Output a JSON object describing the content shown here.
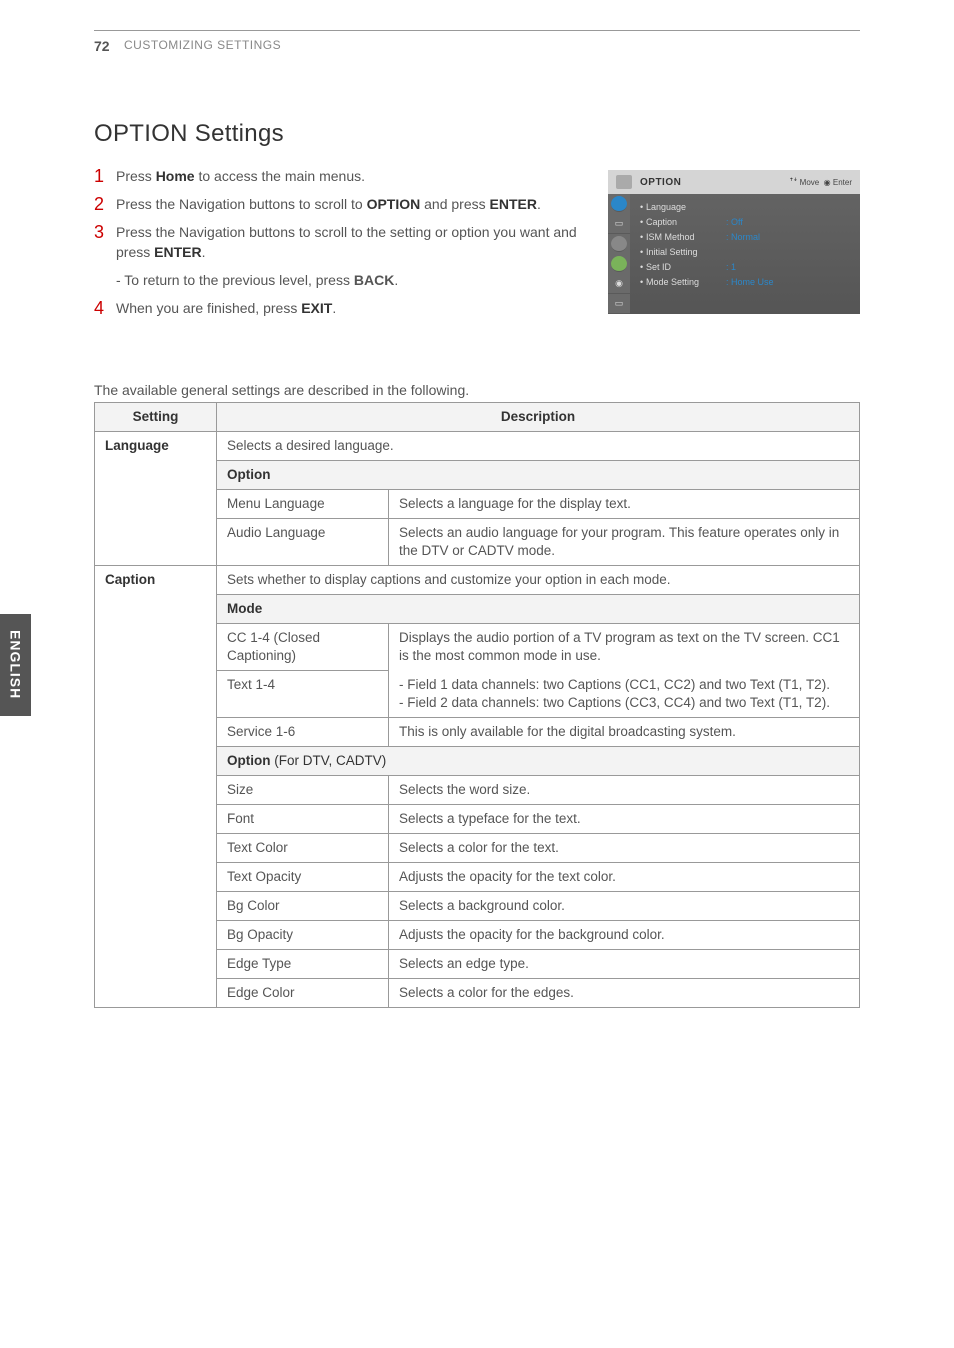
{
  "pageNumber": "72",
  "headerTitle": "CUSTOMIZING SETTINGS",
  "mainHeading": "OPTION Settings",
  "sideTab": "ENGLISH",
  "steps": [
    {
      "num": "1",
      "pre": "Press ",
      "bold1": "Home",
      "post": " to access the main menus."
    },
    {
      "num": "2",
      "pre": "Press the Navigation buttons to scroll to ",
      "bold1": "OPTION",
      "mid": " and press ",
      "bold2": "ENTER",
      "post": "."
    },
    {
      "num": "3",
      "pre": "Press the Navigation buttons to scroll to the setting or option you want and press ",
      "bold1": "ENTER",
      "post": "."
    },
    {
      "num": "4",
      "pre": "When you are finished, press ",
      "bold1": "EXIT",
      "post": "."
    }
  ],
  "returnLine": {
    "pre": "- To return to the previous level, press ",
    "bold": "BACK",
    "post": "."
  },
  "noteLine": "The available general settings are described in the following.",
  "osd": {
    "title": "OPTION",
    "hintMove": "Move",
    "hintEnter": "Enter",
    "rows": [
      {
        "label": "Language",
        "val": ""
      },
      {
        "label": "Caption",
        "val": ": Off"
      },
      {
        "label": "ISM Method",
        "val": ": Normal"
      },
      {
        "label": "Initial Setting",
        "val": ""
      },
      {
        "label": "Set ID",
        "val": ": 1"
      },
      {
        "label": "Mode Setting",
        "val": ": Home Use"
      }
    ]
  },
  "table": {
    "headers": {
      "setting": "Setting",
      "description": "Description"
    },
    "language": {
      "name": "Language",
      "desc": "Selects a desired language.",
      "optionHeader": "Option",
      "rows": [
        {
          "k": "Menu Language",
          "v": "Selects a language for the display text."
        },
        {
          "k": "Audio Language",
          "v": "Selects an audio language for your program. This feature operates only in the DTV or CADTV mode."
        }
      ]
    },
    "caption": {
      "name": "Caption",
      "desc": "Sets whether to display captions and customize your option in each mode.",
      "modeHeader": "Mode",
      "modeRows": {
        "cc": {
          "k": "CC 1-4 (Closed Captioning)",
          "v": "Displays the audio portion of a TV program as text on the TV screen. CC1 is the most common mode in use."
        },
        "text": {
          "k": "Text 1-4",
          "v": "- Field 1 data channels: two Captions (CC1, CC2) and two Text (T1, T2).\n- Field 2 data channels: two Captions (CC3, CC4) and two Text (T1, T2)."
        },
        "service": {
          "k": "Service 1-6",
          "v": "This is only available for the digital broadcasting system."
        }
      },
      "optionHeader": "Option",
      "optionSuffix": " (For DTV, CADTV)",
      "optionRows": [
        {
          "k": "Size",
          "v": "Selects the word size."
        },
        {
          "k": "Font",
          "v": "Selects a typeface for the text."
        },
        {
          "k": "Text Color",
          "v": "Selects a color for the text."
        },
        {
          "k": "Text Opacity",
          "v": "Adjusts the opacity for the text color."
        },
        {
          "k": "Bg Color",
          "v": "Selects a background color."
        },
        {
          "k": "Bg Opacity",
          "v": "Adjusts the opacity for the background color."
        },
        {
          "k": "Edge Type",
          "v": "Selects an edge type."
        },
        {
          "k": "Edge Color",
          "v": "Selects a color for the edges."
        }
      ]
    }
  }
}
